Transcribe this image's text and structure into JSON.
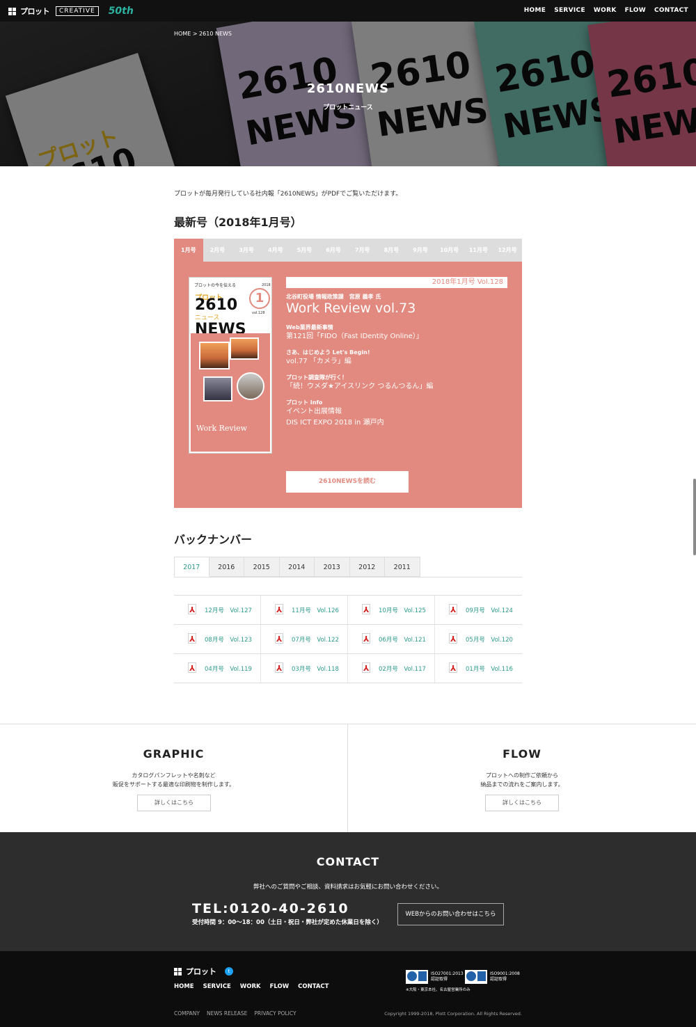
{
  "header": {
    "brand": "プロット",
    "creative": "CREATIVE",
    "anniversary": "50th",
    "nav": [
      "HOME",
      "SERVICE",
      "WORK",
      "FLOW",
      "CONTACT"
    ]
  },
  "hero": {
    "breadcrumb": "HOME  >  2610 NEWS",
    "title": "2610NEWS",
    "subtitle": "プロットニュース"
  },
  "intro": "プロットが毎月発行している社内報「2610NEWS」がPDFでご覧いただけます。",
  "latest": {
    "heading": "最新号（2018年1月号）",
    "month_tabs": [
      "1月号",
      "2月号",
      "3月号",
      "4月号",
      "5月号",
      "6月号",
      "7月号",
      "8月号",
      "9月号",
      "10月号",
      "11月号",
      "12月号"
    ],
    "active_tab": "1月号",
    "accent": "#e28a7f",
    "cover": {
      "tagline": "プロットの今を伝える",
      "year": "2018",
      "brand": "プロット",
      "number": "2610",
      "kana": "ニュース",
      "news": "NEWS",
      "month": "1",
      "vol": "vol.128",
      "work_review": "Work Review"
    },
    "issue": "2018年1月号 Vol.128",
    "items": [
      {
        "label": "北谷町役場 情報政策課　宮原 義孝 氏",
        "lines": [
          "Work Review vol.73"
        ],
        "big": true
      },
      {
        "label": "Web業界最新事情",
        "lines": [
          "第121回「FIDO（Fast IDentity Online）」"
        ]
      },
      {
        "label": "さあ、はじめよう Let's Begin!",
        "lines": [
          "vol.77 「カメラ」編"
        ]
      },
      {
        "label": "プロット調査隊が行く！",
        "lines": [
          "「続！ウメダ★アイスリンク つるんつるん」編"
        ]
      },
      {
        "label": "プロット Info",
        "lines": [
          "イベント出展情報",
          "DIS ICT EXPO 2018 in 瀬戸内"
        ]
      }
    ],
    "read_button": "2610NEWSを読む"
  },
  "backnumber": {
    "heading": "バックナンバー",
    "years": [
      "2017",
      "2016",
      "2015",
      "2014",
      "2013",
      "2012",
      "2011"
    ],
    "active_year": "2017",
    "issues": [
      [
        "12月号　Vol.127",
        "11月号　Vol.126",
        "10月号　Vol.125",
        "09月号　Vol.124"
      ],
      [
        "08月号　Vol.123",
        "07月号　Vol.122",
        "06月号　Vol.121",
        "05月号　Vol.120"
      ],
      [
        "04月号　Vol.119",
        "03月号　Vol.118",
        "02月号　Vol.117",
        "01月号　Vol.116"
      ]
    ],
    "link_color": "#2c9a8c"
  },
  "promo": {
    "graphic": {
      "title": "GRAPHIC",
      "text1": "カタログパンフレットや名刺など",
      "text2": "販促をサポートする最適な印刷物を制作します。",
      "button": "詳しくはこちら"
    },
    "flow": {
      "title": "FLOW",
      "text1": "プロットへの制作ご依頼から",
      "text2": "納品までの流れをご案内します。",
      "button": "詳しくはこちら"
    }
  },
  "contact": {
    "title": "CONTACT",
    "text": "弊社へのご質問やご相談、資料請求はお気軽にお問い合わせください。",
    "tel": "TEL:0120-40-2610",
    "hours": "受付時間 9：00〜18：00（土日・祝日・弊社が定めた休業日を除く）",
    "web_button": "WEBからのお問い合わせはこちら"
  },
  "footer": {
    "brand": "プロット",
    "nav": [
      "HOME",
      "SERVICE",
      "WORK",
      "FLOW",
      "CONTACT"
    ],
    "sub": [
      "COMPANY",
      "NEWS RELEASE",
      "PRIVACY POLICY"
    ],
    "iso1": {
      "line1": "ISO27001:2013",
      "line2": "認証取得"
    },
    "iso2": {
      "line1": "ISO9001:2008",
      "line2": "認証取得"
    },
    "iso_note": "※大阪・東京本社、名古屋営業所のみ",
    "copyright": "Copyright 1999-2018, Plott Corporation. All Rights Reserved."
  }
}
